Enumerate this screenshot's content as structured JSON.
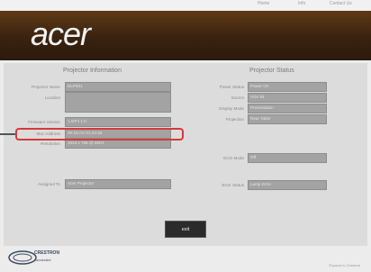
{
  "top_links": [
    "Home",
    "Info",
    "Contact Us"
  ],
  "brand": {
    "logo_text": "acer"
  },
  "projector_information": {
    "title": "Projector Information",
    "fields": [
      {
        "label": "Projector Name",
        "value": "DLP001"
      },
      {
        "label": "Location",
        "value": ""
      },
      {
        "label": "Firmware Version",
        "value": "1.0/PJ 1.0"
      },
      {
        "label": "Mac Address",
        "value": "00:15:AC:01:23:45"
      },
      {
        "label": "Resolution",
        "value": "1024 x 768 @ 60Hz"
      },
      {
        "label": "Assigned To",
        "value": "Acer Projector"
      }
    ]
  },
  "projector_status": {
    "title": "Projector Status",
    "fields": [
      {
        "label": "Power Status",
        "value": "Power On"
      },
      {
        "label": "Source",
        "value": "VGA IN"
      },
      {
        "label": "Display Mode",
        "value": "Presentation"
      },
      {
        "label": "Projection",
        "value": "Rear Table"
      },
      {
        "label": "ECO Mode",
        "value": "Off"
      },
      {
        "label": "Error Status",
        "value": "Lamp Error"
      }
    ]
  },
  "exit_button": {
    "label": "exit"
  },
  "footer": {
    "crestron_text": "CRESTRON",
    "crestron_sub": "connected",
    "right_text": "Expand to Crestron"
  },
  "colors": {
    "banner": "#3a2210",
    "highlight": "#d63a3a",
    "field_bg": "#a3a3a3"
  }
}
